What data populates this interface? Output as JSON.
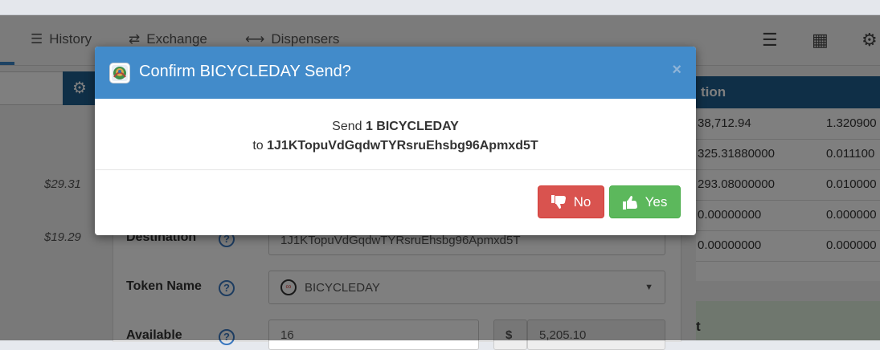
{
  "nav": {
    "history": "History",
    "exchange": "Exchange",
    "dispensers": "Dispensers"
  },
  "background": {
    "amounts": [
      "$29.31",
      "$19.29"
    ],
    "form": {
      "destination_label": "Destination",
      "destination_value": "1J1KTopuVdGqdwTYRsruEhsbg96Apmxd5T",
      "token_label": "Token Name",
      "token_value": "BICYCLEDAY",
      "available_label": "Available",
      "available_value": "16",
      "currency_symbol": "$",
      "usd_value": "5,205.10"
    },
    "table": {
      "header": "tion",
      "rows": [
        [
          "38,712.94",
          "1.320900"
        ],
        [
          "325.31880000",
          "0.011100"
        ],
        [
          "293.08000000",
          "0.010000"
        ],
        [
          "0.00000000",
          "0.000000"
        ],
        [
          "0.00000000",
          "0.000000"
        ]
      ],
      "footer": "t"
    }
  },
  "modal": {
    "title": "Confirm BICYCLEDAY Send?",
    "close": "×",
    "body_send_prefix": "Send ",
    "body_amount": "1 BICYCLEDAY",
    "body_to_prefix": "to ",
    "body_address": "1J1KTopuVdGqdwTYRsruEhsbg96Apmxd5T",
    "no_label": "No",
    "yes_label": "Yes"
  },
  "colors": {
    "header_blue": "#428bca",
    "no_red": "#d9534f",
    "yes_green": "#5cb85c"
  }
}
